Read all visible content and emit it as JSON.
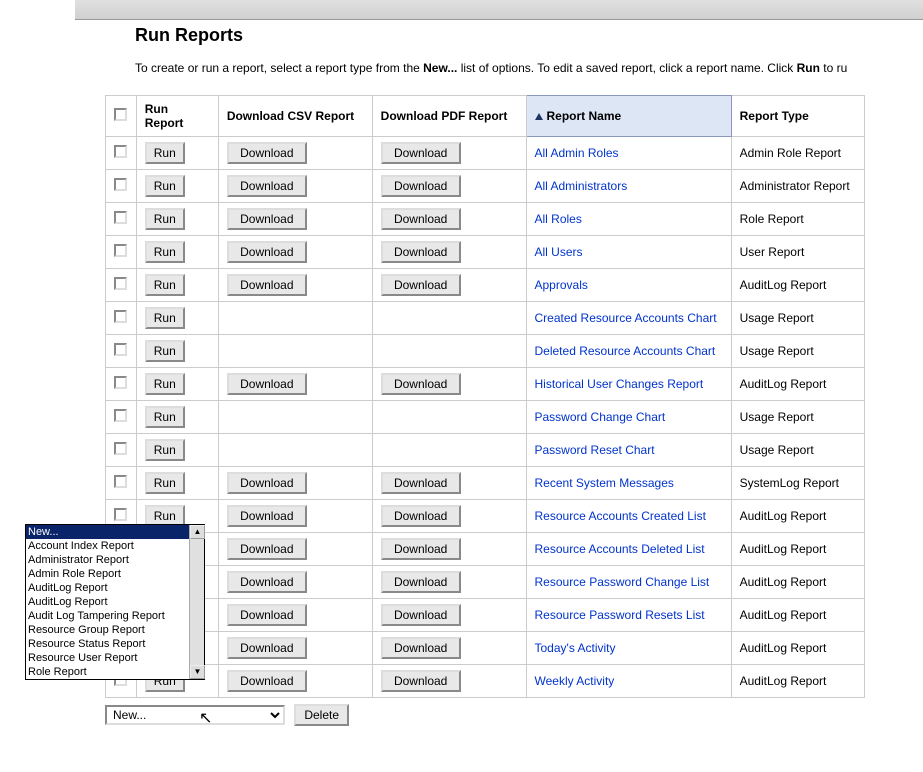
{
  "page": {
    "title": "Run Reports",
    "instruction_prefix": "To create or run a report, select a report type from the ",
    "instruction_bold1": "New...",
    "instruction_mid": " list of options. To edit a saved report, click a report name. Click ",
    "instruction_bold2": "Run",
    "instruction_suffix": " to ru"
  },
  "table": {
    "headers": {
      "checkbox": "",
      "run": "Run Report",
      "csv": "Download CSV Report",
      "pdf": "Download PDF Report",
      "name": "Report Name",
      "type": "Report Type"
    },
    "buttons": {
      "run": "Run",
      "download": "Download"
    },
    "rows": [
      {
        "name": "All Admin Roles",
        "type": "Admin Role Report",
        "csv": true,
        "pdf": true
      },
      {
        "name": "All Administrators",
        "type": "Administrator Report",
        "csv": true,
        "pdf": true
      },
      {
        "name": "All Roles",
        "type": "Role Report",
        "csv": true,
        "pdf": true
      },
      {
        "name": "All Users",
        "type": "User Report",
        "csv": true,
        "pdf": true
      },
      {
        "name": "Approvals",
        "type": "AuditLog Report",
        "csv": true,
        "pdf": true
      },
      {
        "name": "Created Resource Accounts Chart",
        "type": "Usage Report",
        "csv": false,
        "pdf": false
      },
      {
        "name": "Deleted Resource Accounts Chart",
        "type": "Usage Report",
        "csv": false,
        "pdf": false
      },
      {
        "name": "Historical User Changes Report",
        "type": "AuditLog Report",
        "csv": true,
        "pdf": true
      },
      {
        "name": "Password Change Chart",
        "type": "Usage Report",
        "csv": false,
        "pdf": false
      },
      {
        "name": "Password Reset Chart",
        "type": "Usage Report",
        "csv": false,
        "pdf": false
      },
      {
        "name": "Recent System Messages",
        "type": "SystemLog Report",
        "csv": true,
        "pdf": true
      },
      {
        "name": "Resource Accounts Created List",
        "type": "AuditLog Report",
        "csv": true,
        "pdf": true
      },
      {
        "name": "Resource Accounts Deleted List",
        "type": "AuditLog Report",
        "csv": true,
        "pdf": true
      },
      {
        "name": "Resource Password Change List",
        "type": "AuditLog Report",
        "csv": true,
        "pdf": true
      },
      {
        "name": "Resource Password Resets List",
        "type": "AuditLog Report",
        "csv": true,
        "pdf": true
      },
      {
        "name": "Today's Activity",
        "type": "AuditLog Report",
        "csv": true,
        "pdf": true
      },
      {
        "name": "Weekly Activity",
        "type": "AuditLog Report",
        "csv": true,
        "pdf": true
      }
    ]
  },
  "footer": {
    "select_value": "New...",
    "delete_label": "Delete"
  },
  "dropdown": {
    "options": [
      "New...",
      "Account Index Report",
      "Administrator Report",
      "Admin Role Report",
      "AuditLog Report",
      "AuditLog Report",
      "Audit Log Tampering Report",
      "Resource Group Report",
      "Resource Status Report",
      "Resource User Report",
      "Role Report"
    ],
    "selected_index": 0
  }
}
